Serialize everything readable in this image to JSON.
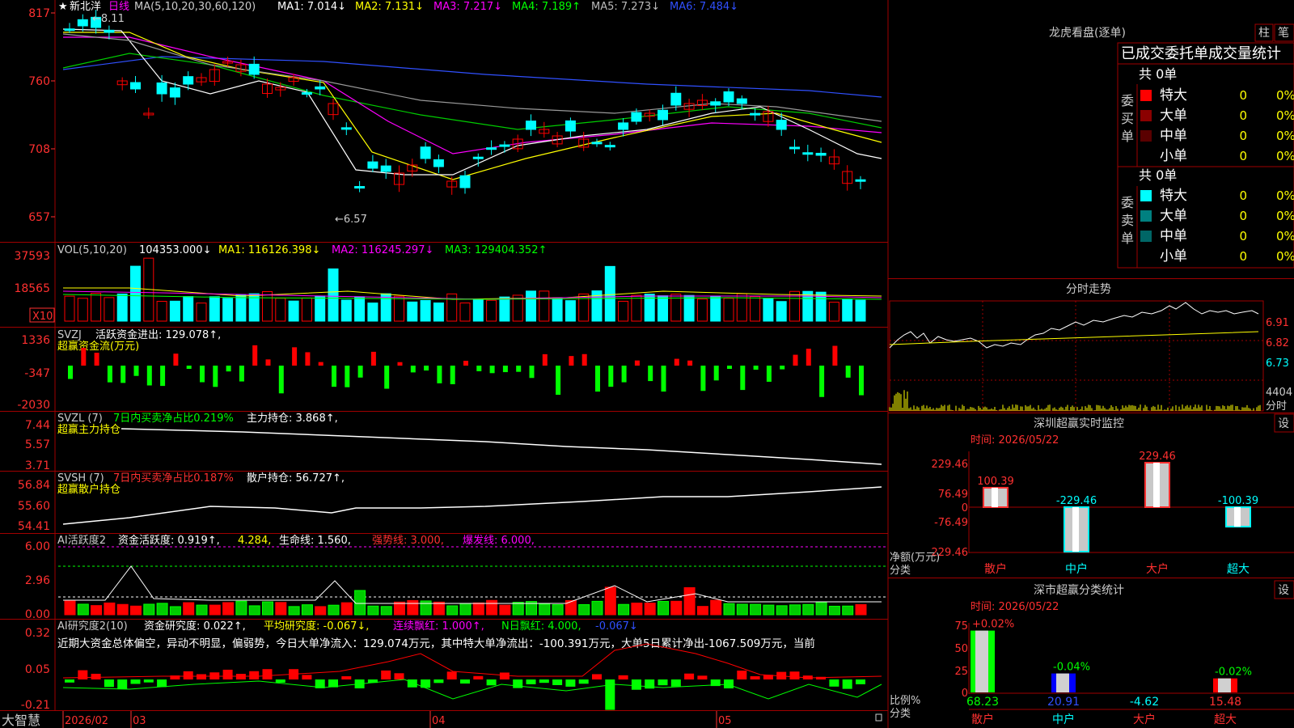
{
  "stock": {
    "star": "★",
    "name": "新北洋",
    "period": "日线"
  },
  "ma_line": {
    "label": "MA(5,10,20,30,60,120)",
    "ma1": "MA1: 7.014↓",
    "ma2": "MA2: 7.131↓",
    "ma3": "MA3: 7.217↓",
    "ma4": "MA4: 7.189↑",
    "ma5": "MA5: 7.273↓",
    "ma6": "MA6: 7.484↓"
  },
  "price_axis": [
    "817",
    "760",
    "708",
    "657"
  ],
  "price_marks": {
    "high": "8.11",
    "low": "6.57"
  },
  "vol_panel": {
    "header": "VOL(5,10,20)",
    "vol": "104353.000↓",
    "ma1": "MA1: 116126.398↓",
    "ma2": "MA2: 116245.297↓",
    "ma3": "MA3: 129404.352↑",
    "axis": [
      "37593",
      "18565"
    ],
    "unit": "X10"
  },
  "svzj_panel": {
    "header": "SVZJ",
    "label": "活跃资金进出: 129.078↑,",
    "sub": "超赢资金流(万元)",
    "axis": [
      "1336",
      "-347",
      "-2030"
    ]
  },
  "svzl_panel": {
    "header": "SVZL (7)",
    "ratio": "7日内买卖净占比0.219%",
    "hold": "主力持仓: 3.868↑,",
    "sub": "超赢主力持仓",
    "axis": [
      "7.44",
      "5.57",
      "3.71"
    ]
  },
  "svsh_panel": {
    "header": "SVSH (7)",
    "ratio": "7日内买卖净占比0.187%",
    "hold": "散户持仓: 56.727↑,",
    "sub": "超赢散户持仓",
    "axis": [
      "56.84",
      "55.60",
      "54.41"
    ]
  },
  "ai_active": {
    "header": "AI活跃度2",
    "label": "资金活跃度: 0.919↑,",
    "v2": "4.284,",
    "life": "生命线: 1.560,",
    "strong": "强势线: 3.000,",
    "burst": "爆发线: 6.000,",
    "axis": [
      "6.00",
      "2.96",
      "0.00"
    ]
  },
  "ai_research": {
    "header": "AI研究度2(10)",
    "label": "资金研究度: 0.022↑,",
    "avg": "平均研究度: -0.067↓,",
    "cont": "连续飘红: 1.000↑,",
    "nday": "N日飘红: 4.000,",
    "nval": "-0.067↓",
    "summary": "近期大资金总体偏空，异动不明显，偏弱势，今日大单净流入：129.074万元，其中特大单净流出：-100.391万元，大单5日累计净出-1067.509万元，当前",
    "axis": [
      "0.32",
      "0.05",
      "-0.21"
    ]
  },
  "date_axis": {
    "logo": "大智慧",
    "labels": [
      "2026/02",
      "03",
      "04",
      "05"
    ]
  },
  "dragon": {
    "title": "龙虎看盘(逐单)",
    "btn_zhu": "柱",
    "btn_bi": "笔",
    "subtitle": "已成交委托单成交量统计",
    "buy": {
      "side": "委买单",
      "total": "共 0单",
      "rows": [
        {
          "name": "特大",
          "count": "0",
          "pct": "0%",
          "color": "#ff0000"
        },
        {
          "name": "大单",
          "count": "0",
          "pct": "0%",
          "color": "#8b0000"
        },
        {
          "name": "中单",
          "count": "0",
          "pct": "0%",
          "color": "#5a0000"
        },
        {
          "name": "小单",
          "count": "0",
          "pct": "0%",
          "color": ""
        }
      ]
    },
    "sell": {
      "side": "委卖单",
      "total": "共 0单",
      "rows": [
        {
          "name": "特大",
          "count": "0",
          "pct": "0%",
          "color": "#00ffff"
        },
        {
          "name": "大单",
          "count": "0",
          "pct": "0%",
          "color": "#008080"
        },
        {
          "name": "中单",
          "count": "0",
          "pct": "0%",
          "color": "#006666"
        },
        {
          "name": "小单",
          "count": "0",
          "pct": "0%",
          "color": ""
        }
      ]
    }
  },
  "intraday": {
    "title": "分时走势",
    "axis": [
      "6.91",
      "6.82",
      "6.73"
    ],
    "vol": "4404",
    "unit": "分时"
  },
  "sz_monitor": {
    "title": "深圳超赢实时监控",
    "btn": "设",
    "time": "时间: 2026/05/22",
    "axis": [
      "229.46",
      "76.49",
      "0",
      "-76.49",
      "-229.46"
    ],
    "left_label_1": "净额(万元)",
    "left_label_2": "分类",
    "bars": [
      {
        "name": "散户",
        "value": 100.39,
        "label": "100.39"
      },
      {
        "name": "中户",
        "value": -229.46,
        "label": "-229.46"
      },
      {
        "name": "大户",
        "value": 229.46,
        "label": "229.46"
      },
      {
        "name": "超大",
        "value": -100.39,
        "label": "-100.39"
      }
    ]
  },
  "sz_class": {
    "title": "深市超赢分类统计",
    "btn": "设",
    "time": "时间: 2026/05/22",
    "axis": [
      "75",
      "50",
      "25",
      "0"
    ],
    "left_label_1": "比例%",
    "left_label_2": "分类",
    "bars": [
      {
        "name": "散户",
        "value": 68.23,
        "top": "+0.02%",
        "label": "68.23",
        "color": "#00ff00"
      },
      {
        "name": "中户",
        "value": 20.91,
        "top": "-0.04%",
        "label": "20.91",
        "color": "#0000ff"
      },
      {
        "name": "大户",
        "value": -4.62,
        "top": "",
        "label": "-4.62",
        "color": "#00ffff"
      },
      {
        "name": "超大",
        "value": 15.48,
        "top": "-0.02%",
        "label": "15.48",
        "color": "#ff0000"
      }
    ]
  },
  "colors": {
    "up": "#ff0000",
    "down": "#00ffff",
    "grid": "#a00000"
  }
}
